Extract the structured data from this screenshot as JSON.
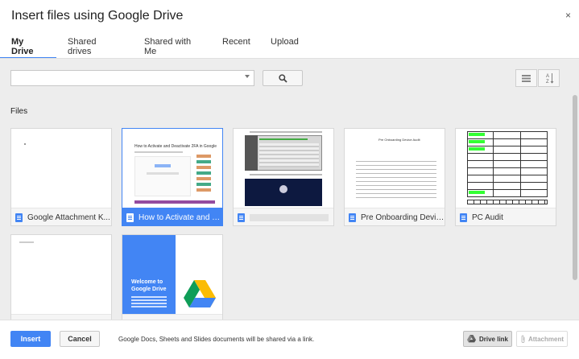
{
  "dialog": {
    "title": "Insert files using Google Drive",
    "close_glyph": "×"
  },
  "tabs": [
    {
      "label": "My Drive",
      "active": true
    },
    {
      "label": "Shared drives",
      "active": false
    },
    {
      "label": "Shared with Me",
      "active": false
    },
    {
      "label": "Recent",
      "active": false
    },
    {
      "label": "Upload",
      "active": false
    }
  ],
  "search": {
    "value": "",
    "placeholder": ""
  },
  "section_label": "Files",
  "thumbs": {
    "twofa_title": "How to Activate and Deactivate 2FA in Google",
    "audit_title": "Pre Onboarding Device Audit",
    "welcome_title": "Welcome to Google Drive"
  },
  "files": [
    {
      "name": "Google Attachment K...",
      "type": "doc",
      "selected": false
    },
    {
      "name": "How to Activate and D...",
      "type": "doc",
      "selected": true
    },
    {
      "name": "",
      "type": "doc",
      "selected": false,
      "name_redacted": true
    },
    {
      "name": "Pre Onboarding Devic...",
      "type": "doc",
      "selected": false
    },
    {
      "name": "PC Audit",
      "type": "doc",
      "selected": false
    },
    {
      "name": "",
      "type": "sheet",
      "selected": false
    },
    {
      "name": "",
      "type": "slide",
      "selected": false
    }
  ],
  "footer": {
    "insert_label": "Insert",
    "cancel_label": "Cancel",
    "notice": "Google Docs, Sheets and Slides documents will be shared via a link.",
    "drive_link_label": "Drive link",
    "attachment_label": "Attachment"
  },
  "colors": {
    "accent": "#4285f4",
    "doc": "#4285f4",
    "sheet": "#0f9d58",
    "slide": "#db4437"
  }
}
